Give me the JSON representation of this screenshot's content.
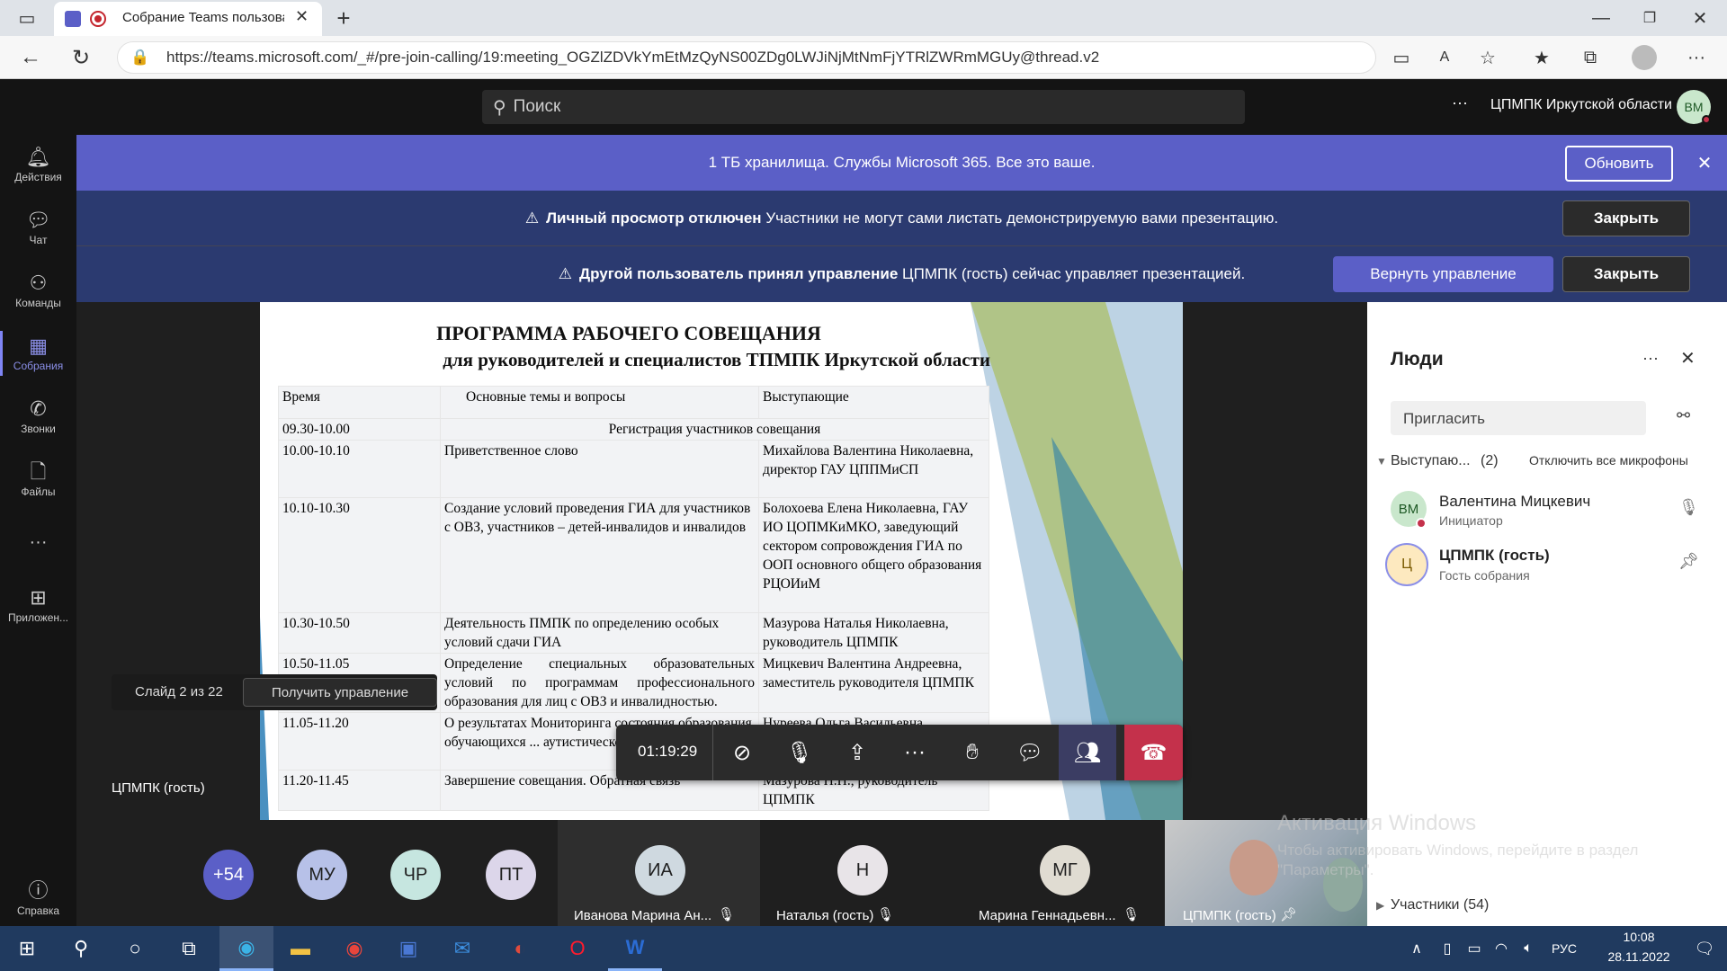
{
  "browser": {
    "tab_title": "Собрание Teams пользова",
    "url": "https://teams.microsoft.com/_#/pre-join-calling/19:meeting_OGZlZDVkYmEtMzQyNS00ZDg0LWJiNjMtNmFjYTRlZWRmMGUy@thread.v2"
  },
  "teams": {
    "search_placeholder": "Поиск",
    "more": "···",
    "org_name": "ЦПМПК Иркутской области",
    "user_initials": "ВМ"
  },
  "rail": [
    {
      "label": "Действия",
      "icon": "bell-icon"
    },
    {
      "label": "Чат",
      "icon": "chat-icon"
    },
    {
      "label": "Команды",
      "icon": "teams-icon"
    },
    {
      "label": "Собрания",
      "icon": "calendar-icon"
    },
    {
      "label": "Звонки",
      "icon": "phone-icon"
    },
    {
      "label": "Файлы",
      "icon": "file-icon"
    },
    {
      "label": "···",
      "icon": "more-icon"
    },
    {
      "label": "Приложен...",
      "icon": "apps-icon"
    }
  ],
  "rail_help": "Справка",
  "banners": {
    "promo_text": "1 ТБ хранилища. Службы Microsoft 365. Все это ваше.",
    "promo_button": "Обновить",
    "private_bold": "Личный просмотр отключен",
    "private_text": "Участники не могут сами листать демонстрируемую вами презентацию.",
    "close_label": "Закрыть",
    "control_bold": "Другой пользователь принял управление",
    "control_text": "ЦПМПК (гость) сейчас управляет презентацией.",
    "return_button": "Вернуть управление"
  },
  "slide": {
    "title1": "ПРОГРАММА РАБОЧЕГО СОВЕЩАНИЯ",
    "title2": "для руководителей и специалистов ТПМПК Иркутской области",
    "headers": [
      "Время",
      "Основные темы и вопросы",
      "Выступающие"
    ],
    "reg_time": "09.30-10.00",
    "reg_text": "Регистрация участников совещания",
    "rows": [
      [
        "10.00-10.10",
        "Приветственное слово",
        "Михайлова Валентина Николаевна, директор ГАУ ЦППМиСП"
      ],
      [
        "10.10-10.30",
        "Создание условий проведения ГИА для участников с ОВЗ, участников – детей-инвалидов и инвалидов",
        "Болохоева Елена Николаевна, ГАУ ИО ЦОПМКиМКО, заведующий сектором сопровождения ГИА по ООП основного общего образования РЦОИиМ"
      ],
      [
        "10.30-10.50",
        "Деятельность ПМПК по определению особых условий сдачи ГИА",
        "Мазурова Наталья Николаевна, руководитель ЦПМПК"
      ],
      [
        "10.50-11.05",
        "Определение специальных образовательных условий по программам профессионального образования для лиц с ОВЗ и инвалидностью.",
        "Мицкевич Валентина Андреевна, заместитель руководителя ЦПМПК"
      ],
      [
        "11.05-11.20",
        "О результатах Мониторинга состояния образования обучающихся ... аутистического спектра в И...",
        "Нуреева Ольга Васильевна ..."
      ],
      [
        "11.20-11.45",
        "Завершение совещания. Обратная связь",
        "Мазурова Н.Н., руководитель ЦПМПК"
      ]
    ],
    "counter": "Слайд 2 из 22",
    "take_control": "Получить управление",
    "presenter": "ЦПМПК (гость)"
  },
  "controls": {
    "timer": "01:19:29"
  },
  "people": {
    "title": "Люди",
    "invite": "Пригласить",
    "presenters_label": "Выступаю...",
    "presenters_count": "(2)",
    "mute_all": "Отключить все микрофоны",
    "list": [
      {
        "initials": "ВМ",
        "name": "Валентина Мицкевич",
        "role": "Инициатор"
      },
      {
        "initials": "Ц",
        "name": "ЦПМПК (гость)",
        "role": "Гость собрания"
      }
    ],
    "participants": "Участники (54)"
  },
  "gallery": {
    "overflow": "+54",
    "avatars": [
      "МУ",
      "ЧР",
      "ПТ"
    ],
    "tiles": [
      {
        "initials": "ИА",
        "name": "Иванова Марина Ан..."
      },
      {
        "initials": "Н",
        "name": "Наталья (гость)"
      },
      {
        "initials": "МГ",
        "name": "Марина Геннадьевн..."
      }
    ],
    "video_name": "ЦПМПК (гость)"
  },
  "watermark": {
    "title": "Активация Windows",
    "text1": "Чтобы активировать Windows, перейдите в раздел",
    "text2": "\"Параметры\"."
  },
  "taskbar": {
    "lang": "РУС",
    "time": "10:08",
    "date": "28.11.2022"
  }
}
